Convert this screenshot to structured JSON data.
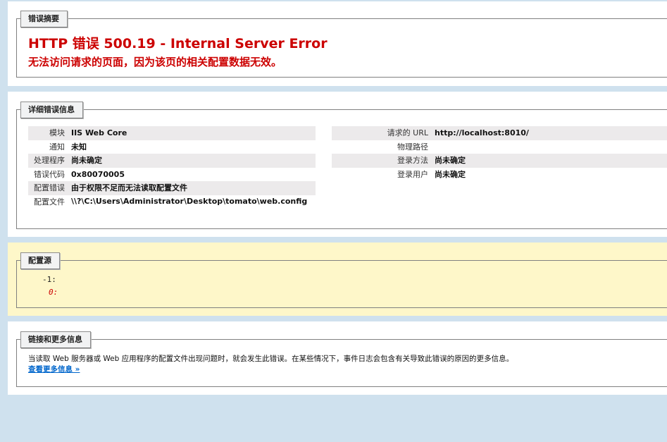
{
  "summary": {
    "legend": "错误摘要",
    "title": "HTTP 错误 500.19 - Internal Server Error",
    "subtitle": "无法访问请求的页面，因为该页的相关配置数据无效。"
  },
  "details": {
    "legend": "详细错误信息",
    "left": [
      {
        "label": "模块",
        "value": "IIS Web Core",
        "shaded": true
      },
      {
        "label": "通知",
        "value": "未知",
        "shaded": false
      },
      {
        "label": "处理程序",
        "value": "尚未确定",
        "shaded": true
      },
      {
        "label": "错误代码",
        "value": "0x80070005",
        "shaded": false
      },
      {
        "label": "配置错误",
        "value": "由于权限不足而无法读取配置文件",
        "shaded": true
      },
      {
        "label": "配置文件",
        "value": "\\\\?\\C:\\Users\\Administrator\\Desktop\\tomato\\web.config",
        "shaded": false
      }
    ],
    "right": [
      {
        "label": "请求的 URL",
        "value": "http://localhost:8010/",
        "shaded": true
      },
      {
        "label": "物理路径",
        "value": "",
        "shaded": false
      },
      {
        "label": "登录方法",
        "value": "尚未确定",
        "shaded": true
      },
      {
        "label": "登录用户",
        "value": "尚未确定",
        "shaded": false
      }
    ]
  },
  "config_source": {
    "legend": "配置源",
    "line1": "-1:",
    "line2": "0:"
  },
  "more_info": {
    "legend": "链接和更多信息",
    "text": "当读取 Web 服务器或 Web 应用程序的配置文件出现问题时，就会发生此错误。在某些情况下，事件日志会包含有关导致此错误的原因的更多信息。",
    "link": "查看更多信息 »"
  },
  "colors": {
    "background": "#cfe1ee",
    "error_red": "#cc0000",
    "link_blue": "#0066cc",
    "config_yellow": "#fef7c9"
  }
}
